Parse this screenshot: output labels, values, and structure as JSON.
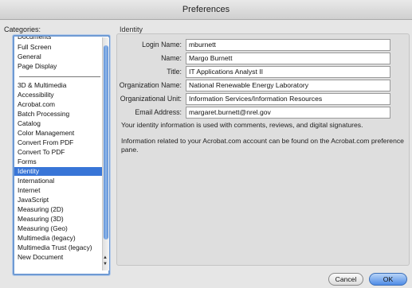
{
  "window": {
    "title": "Preferences"
  },
  "sidebar": {
    "label": "Categories:",
    "items_top": [
      "Documents",
      "Full Screen",
      "General",
      "Page Display"
    ],
    "items": [
      "3D & Multimedia",
      "Accessibility",
      "Acrobat.com",
      "Batch Processing",
      "Catalog",
      "Color Management",
      "Convert From PDF",
      "Convert To PDF",
      "Forms",
      "Identity",
      "International",
      "Internet",
      "JavaScript",
      "Measuring (2D)",
      "Measuring (3D)",
      "Measuring (Geo)",
      "Multimedia (legacy)",
      "Multimedia Trust (legacy)",
      "New Document"
    ],
    "selected": "Identity"
  },
  "panel": {
    "label": "Identity",
    "fields": [
      {
        "label": "Login Name:",
        "value": "mburnett"
      },
      {
        "label": "Name:",
        "value": "Margo Burnett"
      },
      {
        "label": "Title:",
        "value": "IT Applications Analyst II"
      },
      {
        "label": "Organization Name:",
        "value": "National Renewable Energy Laboratory"
      },
      {
        "label": "Organizational Unit:",
        "value": "Information Services/Information Resources"
      },
      {
        "label": "Email Address:",
        "value": "margaret.burnett@nrel.gov"
      }
    ],
    "note1": "Your identity information is used with comments, reviews, and digital signatures.",
    "note2": "Information related to your Acrobat.com account can be found on the Acrobat.com preference pane."
  },
  "buttons": {
    "cancel": "Cancel",
    "ok": "OK"
  },
  "colors": {
    "selection": "#3875d7",
    "ok_button": "#4f8ce6"
  }
}
